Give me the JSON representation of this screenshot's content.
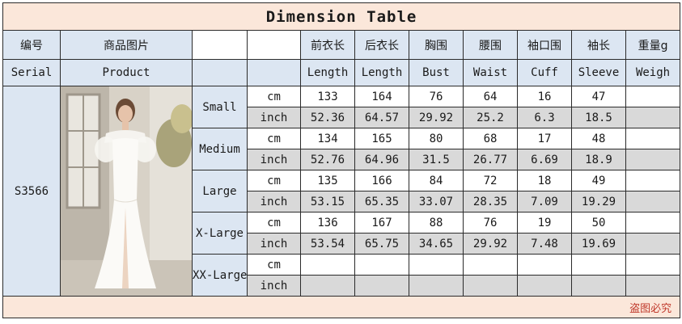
{
  "title": "Dimension Table",
  "header_cn": [
    "编号",
    "商品图片",
    "",
    "",
    "前衣长",
    "后衣长",
    "胸围",
    "腰围",
    "袖口围",
    "袖长",
    "重量g"
  ],
  "header_en": [
    "Serial",
    "Product",
    "",
    "",
    "Length",
    "Length",
    "Bust",
    "Waist",
    "Cuff",
    "Sleeve",
    "Weigh"
  ],
  "serial": "S3566",
  "product_image": "white-off-shoulder-mermaid-gown-photo",
  "units": {
    "cm": "cm",
    "inch": "inch"
  },
  "sizes": [
    {
      "name": "Small",
      "cm": [
        "133",
        "164",
        "76",
        "64",
        "16",
        "47",
        ""
      ],
      "inch": [
        "52.36",
        "64.57",
        "29.92",
        "25.2",
        "6.3",
        "18.5",
        ""
      ]
    },
    {
      "name": "Medium",
      "cm": [
        "134",
        "165",
        "80",
        "68",
        "17",
        "48",
        ""
      ],
      "inch": [
        "52.76",
        "64.96",
        "31.5",
        "26.77",
        "6.69",
        "18.9",
        ""
      ]
    },
    {
      "name": "Large",
      "cm": [
        "135",
        "166",
        "84",
        "72",
        "18",
        "49",
        ""
      ],
      "inch": [
        "53.15",
        "65.35",
        "33.07",
        "28.35",
        "7.09",
        "19.29",
        ""
      ]
    },
    {
      "name": "X-Large",
      "cm": [
        "136",
        "167",
        "88",
        "76",
        "19",
        "50",
        ""
      ],
      "inch": [
        "53.54",
        "65.75",
        "34.65",
        "29.92",
        "7.48",
        "19.69",
        ""
      ]
    },
    {
      "name": "XX-Large",
      "cm": [
        "",
        "",
        "",
        "",
        "",
        "",
        ""
      ],
      "inch": [
        "",
        "",
        "",
        "",
        "",
        "",
        ""
      ]
    }
  ],
  "footer": "盗图必究",
  "colors": {
    "title_bg": "#fbe7da",
    "label_bg": "#dce6f2",
    "inch_row_bg": "#d9d9d9",
    "footer_text": "#c0392b"
  }
}
